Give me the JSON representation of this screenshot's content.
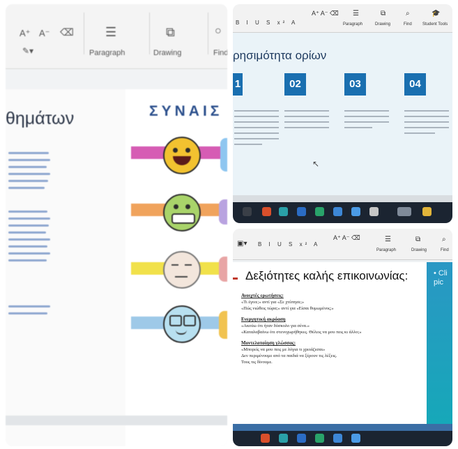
{
  "left_photo": {
    "ribbon": {
      "font_grow": "A⁺",
      "font_shrink": "A⁻",
      "paragraph_label": "Paragraph",
      "drawing_label": "Drawing",
      "find_label": "Find"
    },
    "slide_title_fragment": "θημάτων",
    "emotions_heading": "ΣΥΝΑΙΣ",
    "emotion_row_colors": [
      "#d65cb4",
      "#f0a35c",
      "#f1e14a",
      "#9ec9e8"
    ],
    "emotion_faces": [
      "laughing",
      "grimacing",
      "annoyed",
      "glasses"
    ]
  },
  "top_right_photo": {
    "ribbon": {
      "font_buttons": "B I U S x² A",
      "paragraph_label": "Paragraph",
      "drawing_label": "Drawing",
      "find_label": "Find",
      "student_tools_label": "Student Tools"
    },
    "slide_title": "ρησιμότητα ορίων",
    "steps": [
      "1",
      "02",
      "03",
      "04"
    ],
    "accent_color": "#1a6fb0"
  },
  "bottom_right_photo": {
    "ribbon": {
      "font_buttons": "B I U S x² A",
      "paragraph_label": "Paragraph",
      "drawing_label": "Drawing",
      "find_label": "Find"
    },
    "slide_title": "Δεξιότητες καλής επικοινωνίας:",
    "side_panel_text_1": "• Cli",
    "side_panel_text_2": "pic",
    "sections": [
      {
        "heading": "Ανοιχτές ερωτήσεις:",
        "lines": [
          "«Τι έγινε;» αντί για «Σε χτύπησε;»",
          "«Πώς νιώθεις τώρα;» αντί για «Είσαι θυμωμένος;»"
        ]
      },
      {
        "heading": "Ενεργητική ακρόαση",
        "lines": [
          "«Ακούω ότι ήταν δύσκολο για σένα.»",
          "«Καταλαβαίνω ότι στενοχωρήθηκες. Θέλεις να μου πεις κι άλλο;»"
        ]
      },
      {
        "heading": "Μοντελοποίηση γλώσσας:",
        "lines": [
          "«Μπορείς να μου πεις με λόγια τι χρειάζεσαι»",
          "Δεν περιμένουμε από τα παιδιά να ξέρουν τις λέξεις.",
          "Τους τις δίνουμε."
        ]
      }
    ]
  }
}
